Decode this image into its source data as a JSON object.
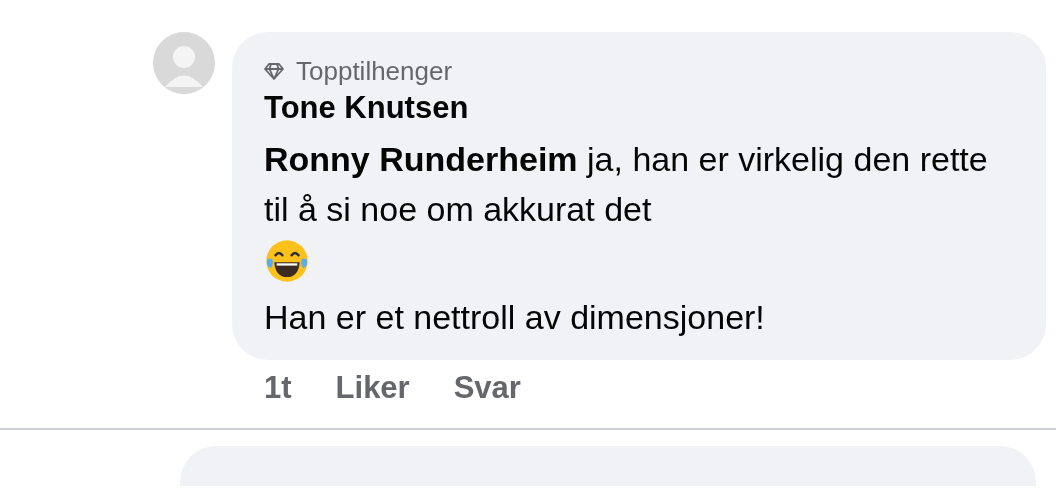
{
  "comment": {
    "badge": "Topptilhenger",
    "author": "Tone Knutsen",
    "paragraphs": [
      "**Ronny Runderheim** ja, han er virkelig den rette til å si noe om akkurat det",
      "Han er et nettroll av dimensjoner!"
    ],
    "time": "1t",
    "actions": [
      "Liker",
      "Svar"
    ]
  }
}
